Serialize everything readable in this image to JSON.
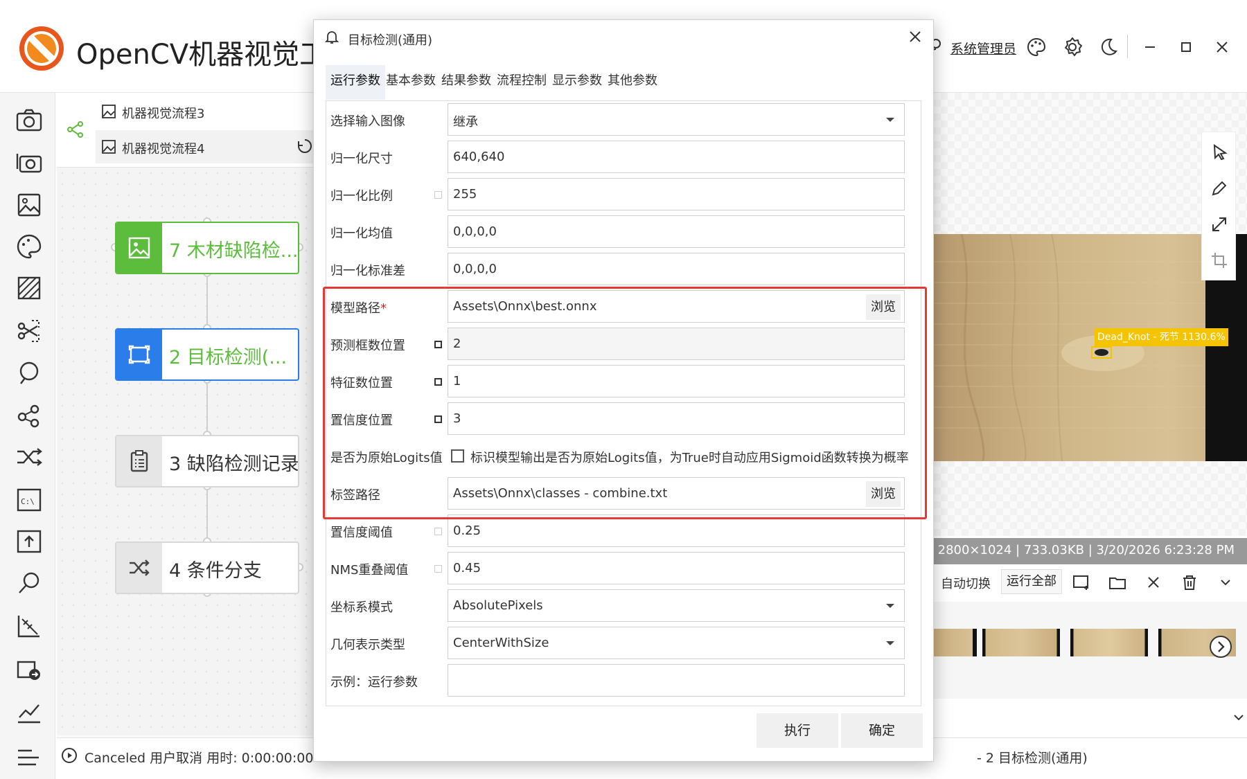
{
  "app": {
    "title": "OpenCV机器视觉工",
    "user": "系统管理员"
  },
  "flow_tabs": [
    {
      "label": "机器视觉流程3"
    },
    {
      "label": "机器视觉流程4"
    }
  ],
  "nodes": [
    {
      "label": "7 木材缺陷检...",
      "color": "#5cbd3c",
      "text_color": "#5cbd3c"
    },
    {
      "label": "2 目标检测(...",
      "color": "#2b7de9",
      "text_color": "#5cbd3c"
    },
    {
      "label": "3 缺陷检测记录",
      "color": "#e6e6e6",
      "text_color": "#333333"
    },
    {
      "label": "4 条件分支",
      "color": "#e6e6e6",
      "text_color": "#333333"
    }
  ],
  "status": {
    "left": "Canceled 用户取消 用时: 0:00:00:00",
    "right": "- 2 目标检测(通用)"
  },
  "image_view": {
    "info": "2800×1024 | 733.03KB | 3/20/2026 6:23:28 PM",
    "detection_label": "Dead_Knot - 死节 1130.6%",
    "detection_color": "#f5c400",
    "auto_switch": "自动切换",
    "run_all": "运行全部"
  },
  "dialog": {
    "title": "目标检测(通用)",
    "tabs": [
      "运行参数",
      "基本参数",
      "结果参数",
      "流程控制",
      "显示参数",
      "其他参数"
    ],
    "active_tab": 0,
    "rows": [
      {
        "label": "选择输入图像",
        "value": "继承",
        "kind": "select"
      },
      {
        "label": "归一化尺寸",
        "value": "640,640",
        "kind": "text"
      },
      {
        "label": "归一化比例",
        "value": "255",
        "kind": "text",
        "pin": "off"
      },
      {
        "label": "归一化均值",
        "value": "0,0,0,0",
        "kind": "text"
      },
      {
        "label": "归一化标准差",
        "value": "0,0,0,0",
        "kind": "text"
      },
      {
        "label": "模型路径",
        "required": "*",
        "value": "Assets\\Onnx\\best.onnx",
        "kind": "browse",
        "browse": "浏览"
      },
      {
        "label": "预测框数位置",
        "value": "2",
        "kind": "gray",
        "pin": "on"
      },
      {
        "label": "特征数位置",
        "value": "1",
        "kind": "text",
        "pin": "on"
      },
      {
        "label": "置信度位置",
        "value": "3",
        "kind": "text",
        "pin": "on"
      },
      {
        "label": "是否为原始Logits值",
        "value": "标识模型输出是否为原始Logits值，为True时自动应用Sigmoid函数转换为概率",
        "kind": "check"
      },
      {
        "label": "标签路径",
        "value": "Assets\\Onnx\\classes - combine.txt",
        "kind": "browse",
        "browse": "浏览"
      },
      {
        "label": "置信度阈值",
        "value": "0.25",
        "kind": "text",
        "pin": "off"
      },
      {
        "label": "NMS重叠阈值",
        "value": "0.45",
        "kind": "text",
        "pin": "off"
      },
      {
        "label": "坐标系模式",
        "value": "AbsolutePixels",
        "kind": "select"
      },
      {
        "label": "几何表示类型",
        "value": "CenterWithSize",
        "kind": "select"
      },
      {
        "label": "示例：运行参数",
        "value": "",
        "kind": "text"
      }
    ],
    "buttons": {
      "execute": "执行",
      "confirm": "确定"
    },
    "highlight_color": "#e53935"
  }
}
